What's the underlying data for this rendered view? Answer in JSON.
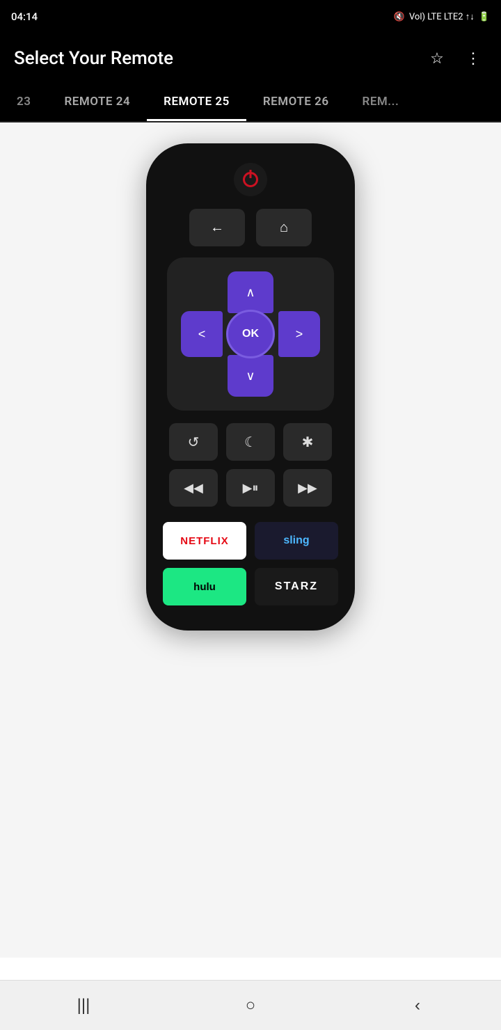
{
  "statusBar": {
    "time": "04:14",
    "icons": [
      "mute",
      "voLTE",
      "signal",
      "battery"
    ]
  },
  "appBar": {
    "title": "Select Your Remote",
    "starIcon": "⭐",
    "moreIcon": "⋮"
  },
  "tabs": [
    {
      "id": "remote-23",
      "label": "23",
      "partial": true,
      "active": false
    },
    {
      "id": "remote-24",
      "label": "REMOTE 24",
      "partial": false,
      "active": false
    },
    {
      "id": "remote-25",
      "label": "REMOTE 25",
      "partial": false,
      "active": true
    },
    {
      "id": "remote-26",
      "label": "REMOTE 26",
      "partial": false,
      "active": false
    },
    {
      "id": "remote-27",
      "label": "REM...",
      "partial": true,
      "active": false
    }
  ],
  "remote": {
    "powerLabel": "⏻",
    "backLabel": "←",
    "homeLabel": "⌂",
    "upLabel": "∧",
    "downLabel": "∨",
    "leftLabel": "<",
    "rightLabel": ">",
    "okLabel": "OK",
    "replayLabel": "↺",
    "sleepLabel": "☾",
    "asteriskLabel": "✱",
    "rewindLabel": "◀◀",
    "playPauseLabel": "▶⏸",
    "fastForwardLabel": "▶▶",
    "netflixLabel": "NETFLIX",
    "slingLabel": "sling",
    "huluLabel": "hulu",
    "starzLabel": "STARZ"
  },
  "navBar": {
    "backButton": "|||",
    "homeButton": "○",
    "recentButton": "‹"
  }
}
